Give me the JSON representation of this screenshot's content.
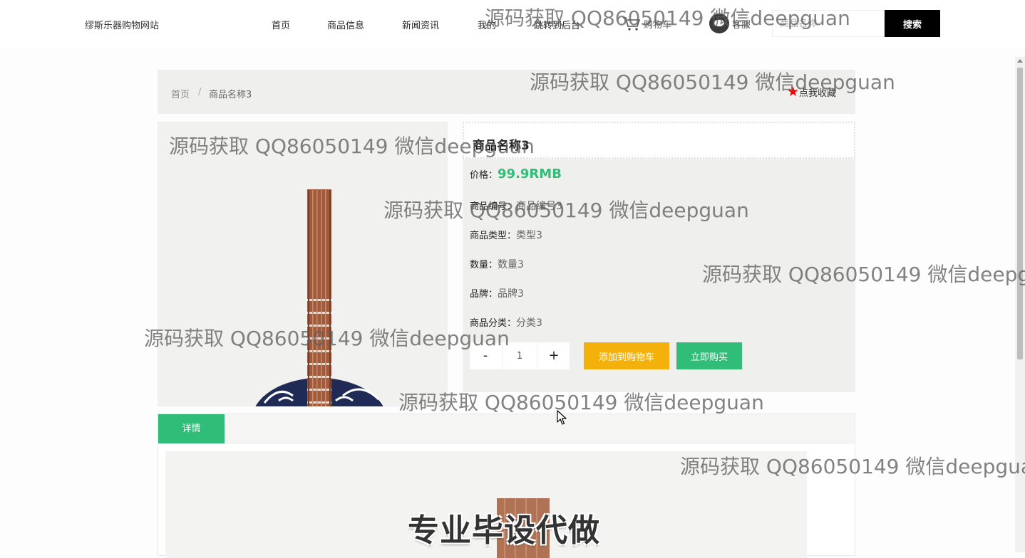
{
  "header": {
    "site_title": "缪斯乐器购物网站",
    "nav": [
      "首页",
      "商品信息",
      "新闻资讯",
      "我的",
      "跳转到后台"
    ],
    "cart_label": "购物车",
    "service_label": "客服",
    "search_placeholder": "商品名称",
    "search_button": "搜索"
  },
  "breadcrumb": {
    "home": "首页",
    "sep": "/",
    "current": "商品名称3"
  },
  "favorite_label": "点我收藏",
  "product": {
    "name": "商品名称3",
    "price_label": "价格：",
    "price": "99.9RMB",
    "fields": [
      {
        "label": "商品编号：",
        "value": "商品编号3"
      },
      {
        "label": "商品类型：",
        "value": "类型3"
      },
      {
        "label": "数量：",
        "value": "数量3"
      },
      {
        "label": "品牌：",
        "value": "品牌3"
      },
      {
        "label": "商品分类：",
        "value": "分类3"
      }
    ],
    "quantity": "1",
    "minus": "-",
    "plus": "+",
    "add_to_cart": "添加到购物车",
    "buy_now": "立即购买"
  },
  "detail": {
    "tab_label": "详情",
    "promo_text": "专业毕设代做"
  },
  "watermark": "源码获取 QQ86050149 微信deepguan",
  "colors": {
    "accent_green": "#2fbd78",
    "cart_yellow": "#f5b10b",
    "favorite_star": "#ff0000"
  }
}
